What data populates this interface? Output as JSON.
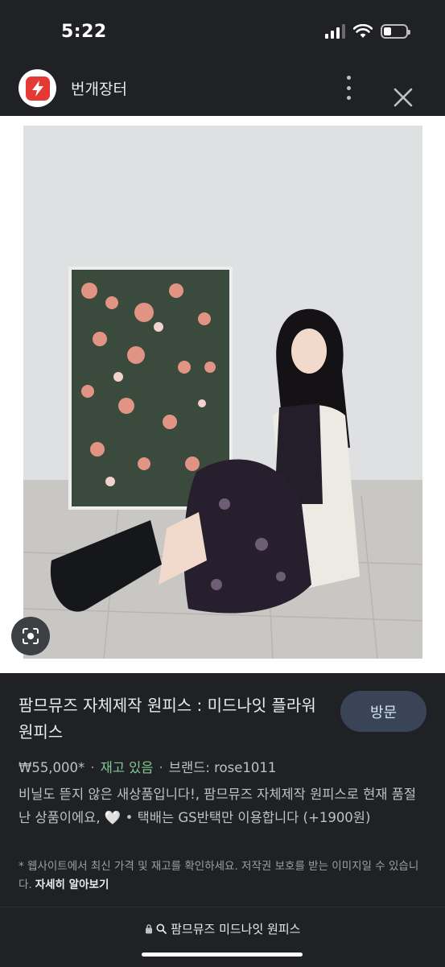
{
  "status_bar": {
    "time": "5:22"
  },
  "app_bar": {
    "app_name": "번개장터"
  },
  "result": {
    "title": "팜므뮤즈 자체제작 원피스 : 미드나잇 플라워 원피스",
    "visit_label": "방문",
    "price": "₩55,000*",
    "separator": "·",
    "stock": "재고 있음",
    "brand": "브랜드: rose1011",
    "description": "비닐도 뜯지 않은 새상품입니다!, 팜므뮤즈 자체제작 원피스로 현재 품절난 상품이에요, 🤍 • 택배는 GS반택만 이용합니다 (+1900원)",
    "note": "* 웹사이트에서 최신 가격 및 재고를 확인하세요. 저작권 보호를 받는 이미지일 수 있습니다.",
    "learn_more": "자세히 알아보기"
  },
  "url_bar": {
    "text": "팜므뮤즈 미드나잇 원피스"
  },
  "icons": [
    "lightning-icon",
    "more-vert-icon",
    "close-icon",
    "lens-icon",
    "lock-icon",
    "search-icon",
    "wifi-icon",
    "signal-icon",
    "battery-icon"
  ],
  "colors": {
    "background": "#202124",
    "visit_button": "#394457",
    "stock": "#81c995",
    "brand": "#e53935"
  }
}
